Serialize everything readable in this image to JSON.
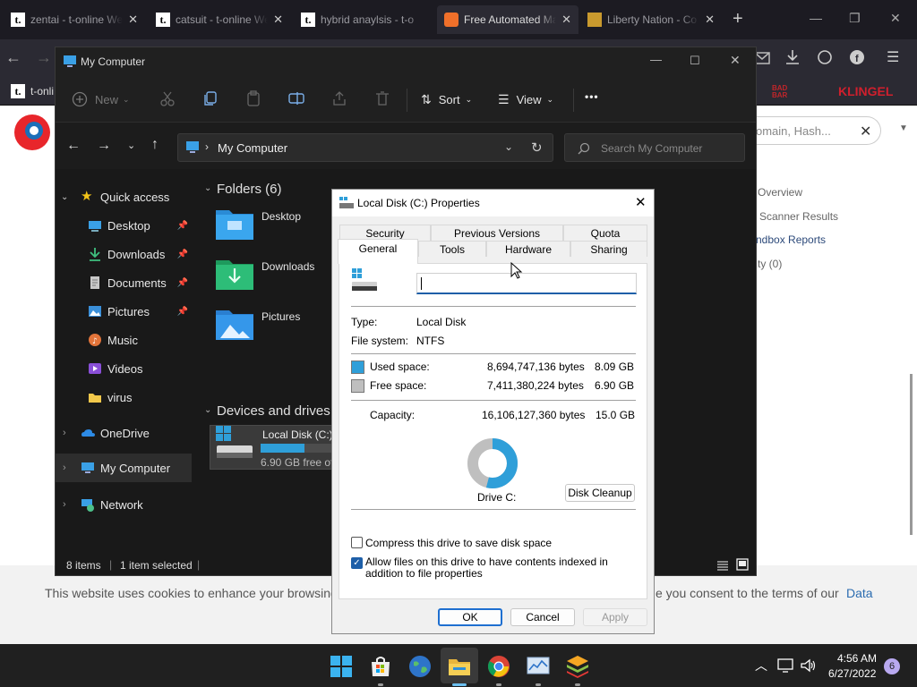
{
  "browser": {
    "tabs": [
      {
        "label": "zentai - t-online Web",
        "icon": "t-online-favicon",
        "active": false
      },
      {
        "label": "catsuit - t-online Web",
        "icon": "t-online-favicon",
        "active": false
      },
      {
        "label": "hybrid anaylsis - t-o",
        "icon": "t-online-favicon",
        "active": false
      },
      {
        "label": "Free Automated Ma",
        "icon": "firefox-favicon",
        "active": true
      },
      {
        "label": "Liberty Nation - Co",
        "icon": "liberty-nation-favicon",
        "active": false
      }
    ],
    "new_tab": "+",
    "bookmarks": {
      "first": "t-onli",
      "klingel": "KLINGEL",
      "red_logo": "BAD BAR"
    },
    "page_search_placeholder": "omain, Hash...",
    "page_menu": [
      "Overview",
      "Scanner Results",
      "ndbox Reports",
      "ty (0)"
    ],
    "cookie_text_left": "This website uses cookies to enhance your browsing",
    "cookie_text_right": "e you consent to the terms of our",
    "cookie_link": "Data"
  },
  "explorer": {
    "title": "My Computer",
    "toolbar": {
      "new": "New",
      "sort": "Sort",
      "view": "View",
      "more": "•••"
    },
    "address": {
      "path": "My Computer",
      "search_placeholder": "Search My Computer"
    },
    "nav": {
      "quick_access": "Quick access",
      "items": [
        {
          "label": "Desktop",
          "icon": "desktop-icon",
          "pinned": true
        },
        {
          "label": "Downloads",
          "icon": "download-icon",
          "pinned": true
        },
        {
          "label": "Documents",
          "icon": "document-icon",
          "pinned": true
        },
        {
          "label": "Pictures",
          "icon": "pictures-icon",
          "pinned": true
        },
        {
          "label": "Music",
          "icon": "music-icon",
          "pinned": false
        },
        {
          "label": "Videos",
          "icon": "videos-icon",
          "pinned": false
        },
        {
          "label": "virus",
          "icon": "folder-icon",
          "pinned": false
        }
      ],
      "onedrive": "OneDrive",
      "my_computer": "My Computer",
      "network": "Network"
    },
    "folders_header": "Folders (6)",
    "folders": [
      "Desktop",
      "Downloads",
      "Pictures"
    ],
    "devices_header": "Devices and drives (",
    "drive": {
      "name": "Local Disk (C:)",
      "free_text": "6.90 GB free of",
      "used_fraction": 0.54
    },
    "status": {
      "items": "8 items",
      "selected": "1 item selected"
    }
  },
  "dialog": {
    "title": "Local Disk (C:) Properties",
    "tabs_row1": [
      "Security",
      "Previous Versions",
      "Quota"
    ],
    "tabs_row2": [
      "General",
      "Tools",
      "Hardware",
      "Sharing"
    ],
    "name_value": "",
    "type_label": "Type:",
    "type_value": "Local Disk",
    "fs_label": "File system:",
    "fs_value": "NTFS",
    "used_label": "Used space:",
    "used_bytes": "8,694,747,136 bytes",
    "used_gb": "8.09 GB",
    "free_label": "Free space:",
    "free_bytes": "7,411,380,224 bytes",
    "free_gb": "6.90 GB",
    "cap_label": "Capacity:",
    "cap_bytes": "16,106,127,360 bytes",
    "cap_gb": "15.0 GB",
    "used_fraction": 0.54,
    "drive_label": "Drive C:",
    "cleanup": "Disk Cleanup",
    "compress": "Compress this drive to save disk space",
    "compress_checked": false,
    "index": "Allow files on this drive to have contents indexed in addition to file properties",
    "index_checked": true,
    "ok": "OK",
    "cancel": "Cancel",
    "apply": "Apply",
    "colors": {
      "used": "#2f9fd9",
      "free": "#bfbfbf"
    }
  },
  "taskbar": {
    "time": "4:56 AM",
    "date": "6/27/2022",
    "notifications": "6",
    "icons": [
      "windows-start-icon",
      "store-icon",
      "globe-icon",
      "file-explorer-icon",
      "chrome-icon",
      "monitor-icon",
      "stack-icon"
    ]
  }
}
